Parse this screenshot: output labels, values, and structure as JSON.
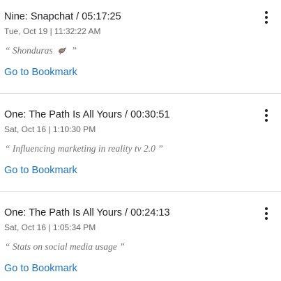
{
  "bookmarks": [
    {
      "title": "Nine: Snapchat / 05:17:25",
      "timestamp": "Tue, Oct 19 | 11:32:22 AM",
      "note_open": "“ Shonduras",
      "note_close": "”",
      "note_icon": "pigeon-emoji",
      "link_label": "Go to Bookmark",
      "menu_icon": "more-vert-icon"
    },
    {
      "title": "One: The Path Is All Yours / 00:30:51",
      "timestamp": "Sat, Oct 16 | 1:10:30 PM",
      "note": "“ Influencing marketing in reality tv 2.0 ”",
      "link_label": "Go to Bookmark",
      "menu_icon": "more-vert-icon"
    },
    {
      "title": "One: The Path Is All Yours / 00:24:13",
      "timestamp": "Sat, Oct 16 | 1:05:34 PM",
      "note": "“ Stats on social media usage ”",
      "link_label": "Go to Bookmark",
      "menu_icon": "more-vert-icon"
    }
  ],
  "colors": {
    "link": "#1a73b8",
    "title": "#202124",
    "timestamp": "#666666",
    "note": "#707070",
    "divider": "#e0e0e0"
  }
}
